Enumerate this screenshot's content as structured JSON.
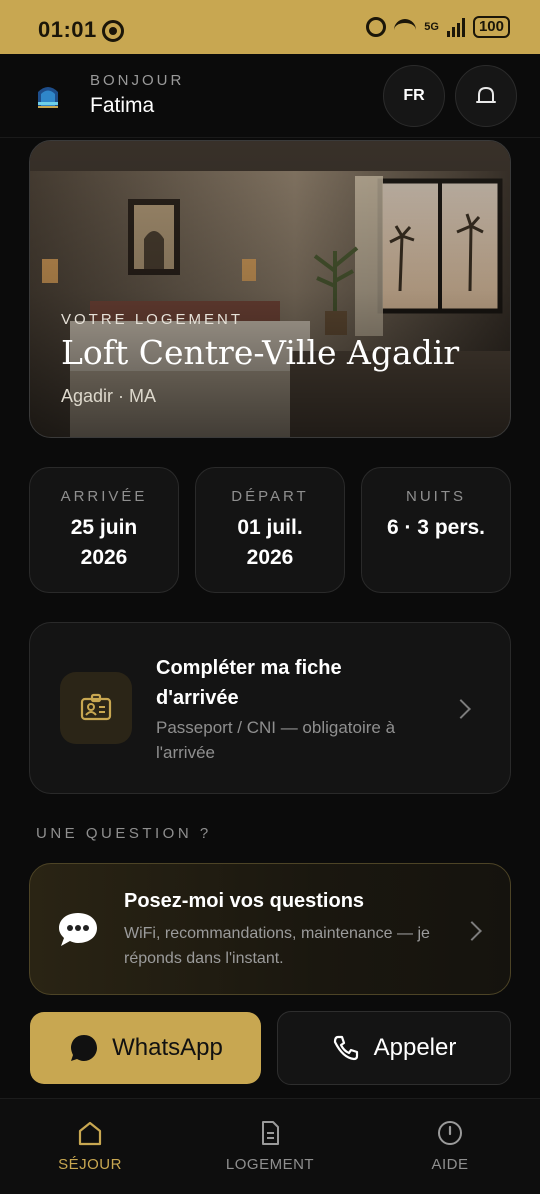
{
  "status_bar": {
    "time": "01:01",
    "network": "5G",
    "battery": "100"
  },
  "header": {
    "greeting": "BONJOUR",
    "user_name": "Fatima",
    "language": "FR"
  },
  "hero": {
    "kicker": "VOTRE LOGEMENT",
    "title": "Loft Centre-Ville Agadir",
    "location": "Agadir · MA"
  },
  "stats": {
    "arrival": {
      "label": "ARRIVÉE",
      "line1": "25 juin",
      "line2": "2026"
    },
    "departure": {
      "label": "DÉPART",
      "line1": "01 juil.",
      "line2": "2026"
    },
    "nights": {
      "label": "NUITS",
      "line1": "6 · 3 pers."
    }
  },
  "checkin": {
    "title": "Compléter ma fiche d'arrivée",
    "subtitle": "Passeport / CNI — obligatoire à l'arrivée"
  },
  "question_section": "UNE QUESTION ?",
  "assistant": {
    "title": "Posez-moi vos questions",
    "subtitle": "WiFi, recommandations, maintenance — je réponds dans l'instant."
  },
  "actions": {
    "whatsapp": "WhatsApp",
    "call": "Appeler"
  },
  "nav": {
    "stay": "SÉJOUR",
    "lodging": "LOGEMENT",
    "help": "AIDE",
    "active": "stay"
  },
  "colors": {
    "accent": "#c8a751",
    "background": "#0b0b0b",
    "card": "#141414"
  }
}
